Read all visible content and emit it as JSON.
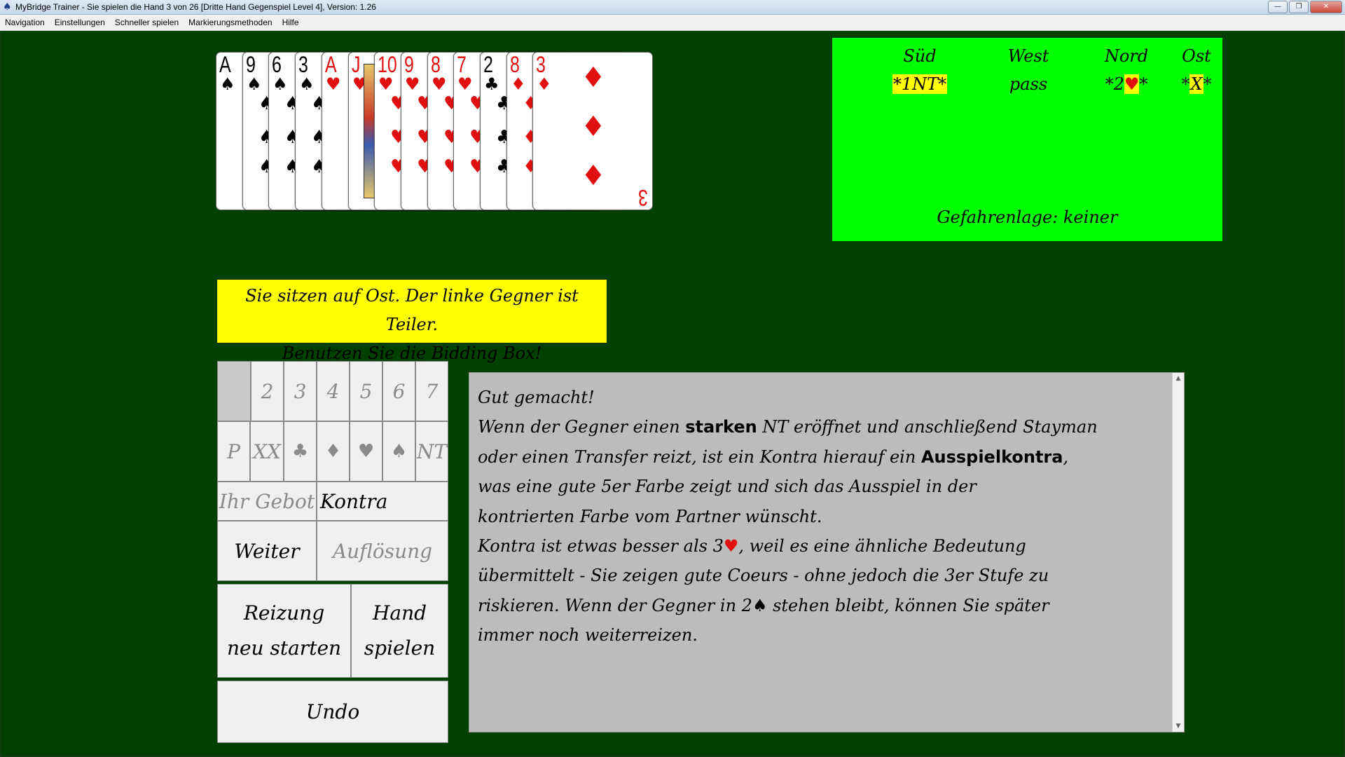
{
  "window": {
    "title": "MyBridge Trainer - Sie spielen die Hand 3 von 26 [Dritte Hand Gegenspiel Level 4], Version: 1.26",
    "icon": "spade-icon"
  },
  "menu": {
    "items": [
      "Navigation",
      "Einstellungen",
      "Schneller spielen",
      "Markierungsmethoden",
      "Hilfe"
    ]
  },
  "hand": {
    "cards": [
      {
        "rank": "A",
        "suit": "♠",
        "color": "black"
      },
      {
        "rank": "9",
        "suit": "♠",
        "color": "black"
      },
      {
        "rank": "6",
        "suit": "♠",
        "color": "black"
      },
      {
        "rank": "3",
        "suit": "♠",
        "color": "black"
      },
      {
        "rank": "A",
        "suit": "♥",
        "color": "red"
      },
      {
        "rank": "J",
        "suit": "♥",
        "color": "red"
      },
      {
        "rank": "10",
        "suit": "♥",
        "color": "red"
      },
      {
        "rank": "9",
        "suit": "♥",
        "color": "red"
      },
      {
        "rank": "8",
        "suit": "♥",
        "color": "red"
      },
      {
        "rank": "7",
        "suit": "♥",
        "color": "red"
      },
      {
        "rank": "2",
        "suit": "♣",
        "color": "black"
      },
      {
        "rank": "8",
        "suit": "♦",
        "color": "red"
      },
      {
        "rank": "3",
        "suit": "♦",
        "color": "red"
      }
    ]
  },
  "auction": {
    "headers": [
      "Süd",
      "West",
      "Nord",
      "Ost"
    ],
    "bids": {
      "sued": "*1NT*",
      "west": "pass",
      "nord_pre": "*2",
      "nord_suit": "♥",
      "nord_post": "*",
      "ost_pre": "*",
      "ost_mid": "X",
      "ost_post": "*"
    },
    "vulnerability": "Gefahrenlage: keiner"
  },
  "banner": {
    "line1": "Sie sitzen auf Ost. Der linke Gegner ist Teiler.",
    "line2": "Benutzen Sie die Bidding Box!"
  },
  "bidding_box": {
    "levels": [
      "2",
      "3",
      "4",
      "5",
      "6",
      "7"
    ],
    "calls": [
      "P",
      "XX",
      "♣",
      "♦",
      "♥",
      "♠",
      "NT"
    ],
    "your_bid_label": "Ihr Gebot",
    "your_bid_value": "Kontra",
    "next_button": "Weiter",
    "solution_button": "Auflösung",
    "restart_line1": "Reizung",
    "restart_line2": "neu starten",
    "play_line1": "Hand",
    "play_line2": "spielen",
    "undo_button": "Undo"
  },
  "explanation": {
    "l1": "Gut gemacht!",
    "l2a": "Wenn der Gegner einen ",
    "l2b": "starken",
    "l2c": " NT eröffnet und anschließend Stayman",
    "l3a": "oder einen Transfer reizt, ist ein Kontra hierauf ein ",
    "l3b": "Ausspielkontra",
    "l3c": ",",
    "l4": "was eine gute 5er Farbe zeigt und sich das Ausspiel in der",
    "l5": "kontrierten Farbe vom Partner wünscht.",
    "l6a": "Kontra ist etwas besser als 3",
    "l6suit": "♥",
    "l6b": ", weil es eine ähnliche Bedeutung",
    "l7": "übermittelt - Sie zeigen gute Coeurs - ohne jedoch die 3er Stufe zu",
    "l8a": "riskieren. Wenn der Gegner in 2",
    "l8suit": "♠",
    "l8b": " stehen bleibt, können Sie später",
    "l9": "immer noch weiterreizen."
  }
}
